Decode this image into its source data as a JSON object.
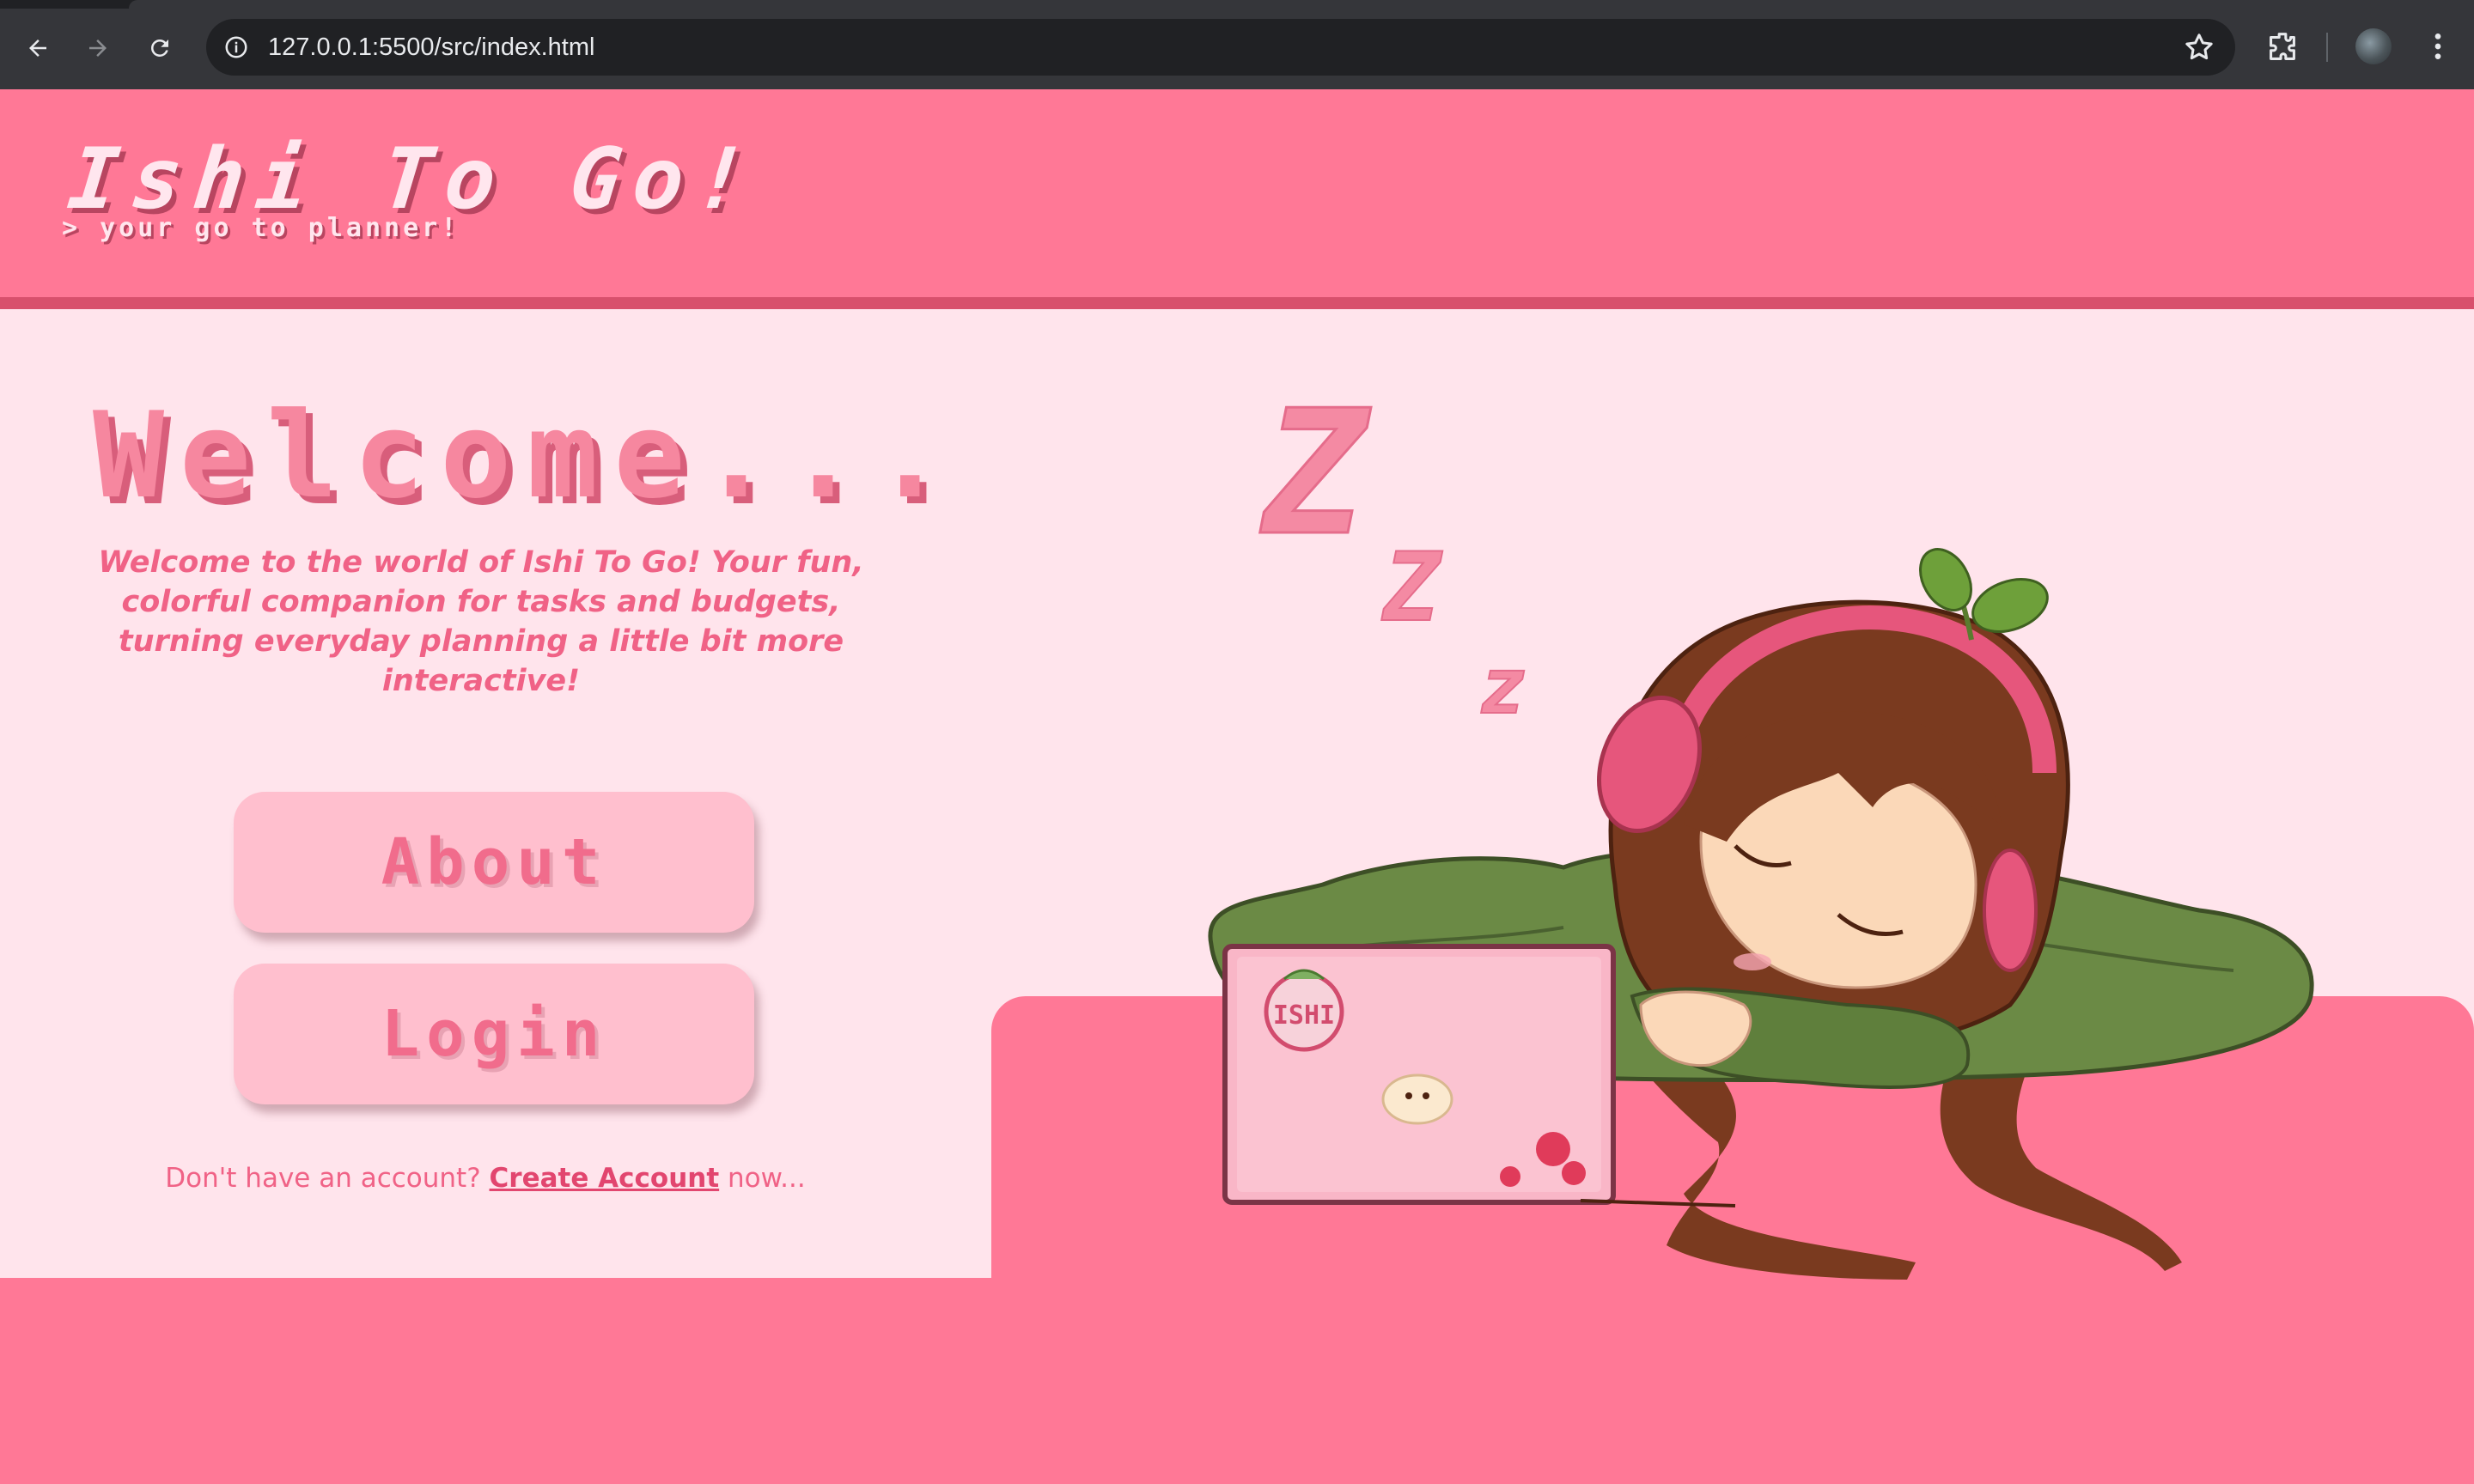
{
  "browser": {
    "url": "127.0.0.1:5500/src/index.html"
  },
  "header": {
    "logo": "Ishi To Go!",
    "tagline": "> your go to planner!"
  },
  "main": {
    "heading": "Welcome...",
    "intro": "Welcome to the world of Ishi To Go! Your fun, colorful companion for tasks and budgets, turning everyday planning a little bit more interactive!",
    "about_label": "About",
    "login_label": "Login",
    "signup_prefix": "Don't have an account?",
    "signup_link": "Create Account",
    "signup_suffix": "now..."
  },
  "illustration": {
    "sleep_text": [
      "Z",
      "Z",
      "z"
    ],
    "laptop_sticker": "ISHI"
  },
  "colors": {
    "primary_pink": "#ff7896",
    "panel_bg": "#ffe4ec",
    "button_bg": "#ffbfce",
    "text_pink": "#f06286"
  }
}
